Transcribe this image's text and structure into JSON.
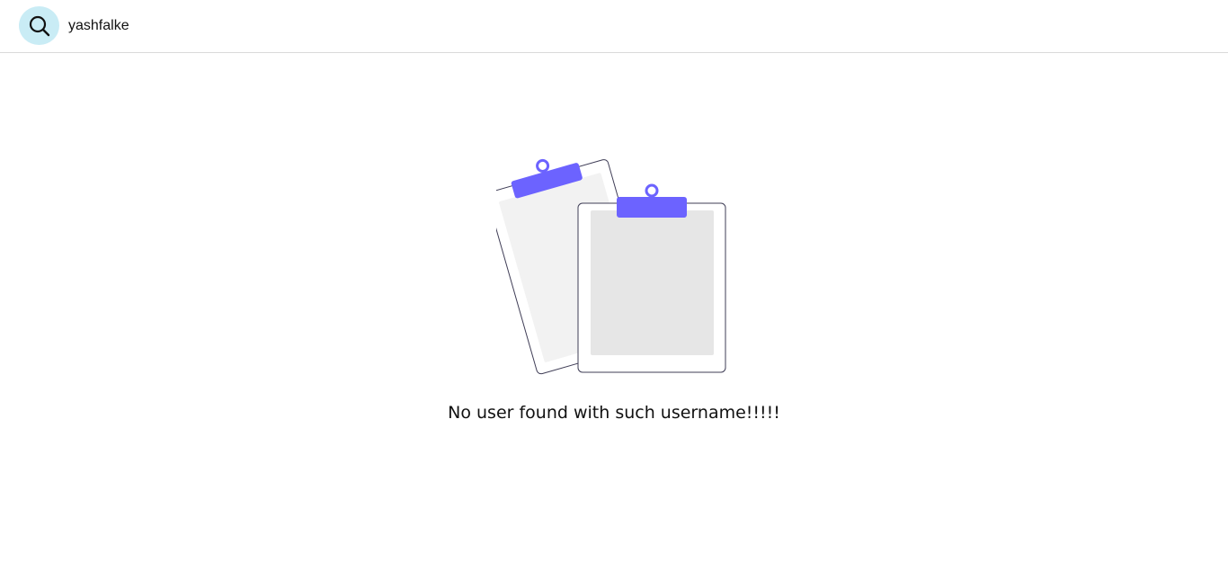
{
  "search": {
    "value": "yashfalke",
    "icon": "search-icon"
  },
  "empty_state": {
    "illustration": "empty-clipboards-illustration",
    "message": "No user found with such username!!!!!",
    "accent_color": "#6c63ff"
  },
  "colors": {
    "search_button_bg": "#c9ecf5",
    "divider": "#d9d9d9",
    "clipboard_back_paper": "#f2f2f2",
    "clipboard_front_paper": "#e6e6e6"
  }
}
